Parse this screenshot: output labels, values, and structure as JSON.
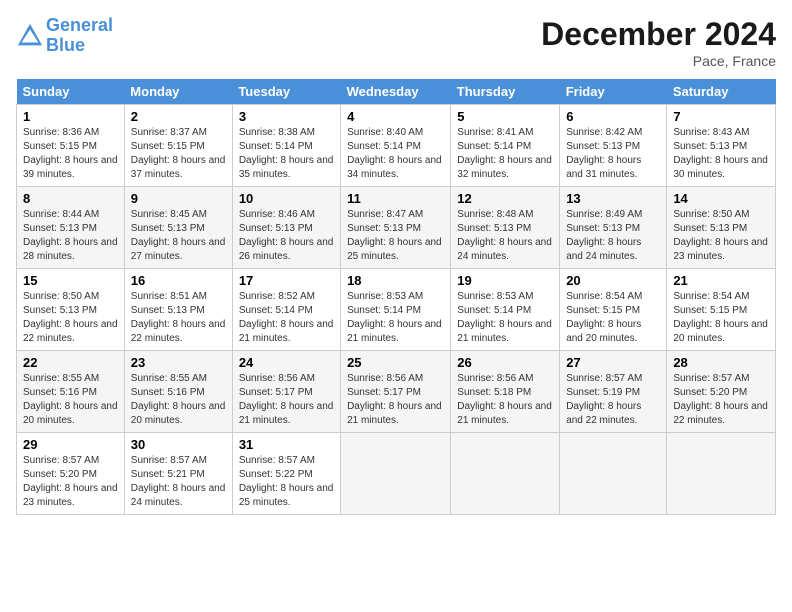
{
  "header": {
    "logo_line1": "General",
    "logo_line2": "Blue",
    "month_title": "December 2024",
    "location": "Pace, France"
  },
  "days_of_week": [
    "Sunday",
    "Monday",
    "Tuesday",
    "Wednesday",
    "Thursday",
    "Friday",
    "Saturday"
  ],
  "weeks": [
    [
      {
        "day": "1",
        "sunrise": "Sunrise: 8:36 AM",
        "sunset": "Sunset: 5:15 PM",
        "daylight": "Daylight: 8 hours and 39 minutes."
      },
      {
        "day": "2",
        "sunrise": "Sunrise: 8:37 AM",
        "sunset": "Sunset: 5:15 PM",
        "daylight": "Daylight: 8 hours and 37 minutes."
      },
      {
        "day": "3",
        "sunrise": "Sunrise: 8:38 AM",
        "sunset": "Sunset: 5:14 PM",
        "daylight": "Daylight: 8 hours and 35 minutes."
      },
      {
        "day": "4",
        "sunrise": "Sunrise: 8:40 AM",
        "sunset": "Sunset: 5:14 PM",
        "daylight": "Daylight: 8 hours and 34 minutes."
      },
      {
        "day": "5",
        "sunrise": "Sunrise: 8:41 AM",
        "sunset": "Sunset: 5:14 PM",
        "daylight": "Daylight: 8 hours and 32 minutes."
      },
      {
        "day": "6",
        "sunrise": "Sunrise: 8:42 AM",
        "sunset": "Sunset: 5:13 PM",
        "daylight": "Daylight: 8 hours and 31 minutes."
      },
      {
        "day": "7",
        "sunrise": "Sunrise: 8:43 AM",
        "sunset": "Sunset: 5:13 PM",
        "daylight": "Daylight: 8 hours and 30 minutes."
      }
    ],
    [
      {
        "day": "8",
        "sunrise": "Sunrise: 8:44 AM",
        "sunset": "Sunset: 5:13 PM",
        "daylight": "Daylight: 8 hours and 28 minutes."
      },
      {
        "day": "9",
        "sunrise": "Sunrise: 8:45 AM",
        "sunset": "Sunset: 5:13 PM",
        "daylight": "Daylight: 8 hours and 27 minutes."
      },
      {
        "day": "10",
        "sunrise": "Sunrise: 8:46 AM",
        "sunset": "Sunset: 5:13 PM",
        "daylight": "Daylight: 8 hours and 26 minutes."
      },
      {
        "day": "11",
        "sunrise": "Sunrise: 8:47 AM",
        "sunset": "Sunset: 5:13 PM",
        "daylight": "Daylight: 8 hours and 25 minutes."
      },
      {
        "day": "12",
        "sunrise": "Sunrise: 8:48 AM",
        "sunset": "Sunset: 5:13 PM",
        "daylight": "Daylight: 8 hours and 24 minutes."
      },
      {
        "day": "13",
        "sunrise": "Sunrise: 8:49 AM",
        "sunset": "Sunset: 5:13 PM",
        "daylight": "Daylight: 8 hours and 24 minutes."
      },
      {
        "day": "14",
        "sunrise": "Sunrise: 8:50 AM",
        "sunset": "Sunset: 5:13 PM",
        "daylight": "Daylight: 8 hours and 23 minutes."
      }
    ],
    [
      {
        "day": "15",
        "sunrise": "Sunrise: 8:50 AM",
        "sunset": "Sunset: 5:13 PM",
        "daylight": "Daylight: 8 hours and 22 minutes."
      },
      {
        "day": "16",
        "sunrise": "Sunrise: 8:51 AM",
        "sunset": "Sunset: 5:13 PM",
        "daylight": "Daylight: 8 hours and 22 minutes."
      },
      {
        "day": "17",
        "sunrise": "Sunrise: 8:52 AM",
        "sunset": "Sunset: 5:14 PM",
        "daylight": "Daylight: 8 hours and 21 minutes."
      },
      {
        "day": "18",
        "sunrise": "Sunrise: 8:53 AM",
        "sunset": "Sunset: 5:14 PM",
        "daylight": "Daylight: 8 hours and 21 minutes."
      },
      {
        "day": "19",
        "sunrise": "Sunrise: 8:53 AM",
        "sunset": "Sunset: 5:14 PM",
        "daylight": "Daylight: 8 hours and 21 minutes."
      },
      {
        "day": "20",
        "sunrise": "Sunrise: 8:54 AM",
        "sunset": "Sunset: 5:15 PM",
        "daylight": "Daylight: 8 hours and 20 minutes."
      },
      {
        "day": "21",
        "sunrise": "Sunrise: 8:54 AM",
        "sunset": "Sunset: 5:15 PM",
        "daylight": "Daylight: 8 hours and 20 minutes."
      }
    ],
    [
      {
        "day": "22",
        "sunrise": "Sunrise: 8:55 AM",
        "sunset": "Sunset: 5:16 PM",
        "daylight": "Daylight: 8 hours and 20 minutes."
      },
      {
        "day": "23",
        "sunrise": "Sunrise: 8:55 AM",
        "sunset": "Sunset: 5:16 PM",
        "daylight": "Daylight: 8 hours and 20 minutes."
      },
      {
        "day": "24",
        "sunrise": "Sunrise: 8:56 AM",
        "sunset": "Sunset: 5:17 PM",
        "daylight": "Daylight: 8 hours and 21 minutes."
      },
      {
        "day": "25",
        "sunrise": "Sunrise: 8:56 AM",
        "sunset": "Sunset: 5:17 PM",
        "daylight": "Daylight: 8 hours and 21 minutes."
      },
      {
        "day": "26",
        "sunrise": "Sunrise: 8:56 AM",
        "sunset": "Sunset: 5:18 PM",
        "daylight": "Daylight: 8 hours and 21 minutes."
      },
      {
        "day": "27",
        "sunrise": "Sunrise: 8:57 AM",
        "sunset": "Sunset: 5:19 PM",
        "daylight": "Daylight: 8 hours and 22 minutes."
      },
      {
        "day": "28",
        "sunrise": "Sunrise: 8:57 AM",
        "sunset": "Sunset: 5:20 PM",
        "daylight": "Daylight: 8 hours and 22 minutes."
      }
    ],
    [
      {
        "day": "29",
        "sunrise": "Sunrise: 8:57 AM",
        "sunset": "Sunset: 5:20 PM",
        "daylight": "Daylight: 8 hours and 23 minutes."
      },
      {
        "day": "30",
        "sunrise": "Sunrise: 8:57 AM",
        "sunset": "Sunset: 5:21 PM",
        "daylight": "Daylight: 8 hours and 24 minutes."
      },
      {
        "day": "31",
        "sunrise": "Sunrise: 8:57 AM",
        "sunset": "Sunset: 5:22 PM",
        "daylight": "Daylight: 8 hours and 25 minutes."
      },
      null,
      null,
      null,
      null
    ]
  ]
}
